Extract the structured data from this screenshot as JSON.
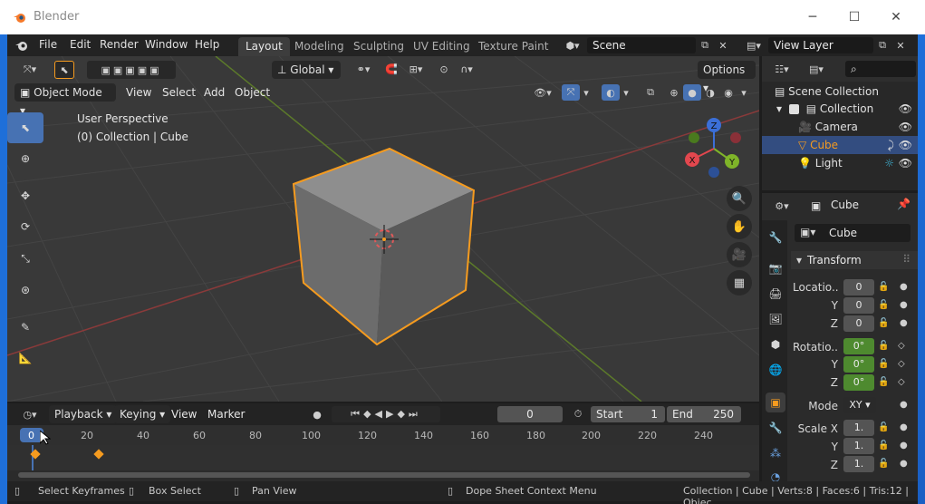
{
  "window": {
    "title": "Blender",
    "minimize": "─",
    "maximize": "☐",
    "close": "✕"
  },
  "menu": [
    "File",
    "Edit",
    "Render",
    "Window",
    "Help"
  ],
  "workspaces": [
    "Layout",
    "Modeling",
    "Sculpting",
    "UV Editing",
    "Texture Paint"
  ],
  "active_workspace": "Layout",
  "scene": {
    "label": "Scene"
  },
  "view_layer": {
    "label": "View Layer"
  },
  "viewport": {
    "transform_orientation": "Global",
    "options": "Options",
    "mode": "Object Mode",
    "menus": [
      "View",
      "Select",
      "Add",
      "Object"
    ],
    "overlay_title": "User Perspective",
    "overlay_subtitle": "(0) Collection | Cube",
    "gizmo": {
      "x": "X",
      "y": "Y",
      "z": "Z"
    }
  },
  "timeline": {
    "menus": [
      "Playback",
      "Keying",
      "View",
      "Marker"
    ],
    "current_frame": "0",
    "start_label": "Start",
    "start_value": "1",
    "end_label": "End",
    "end_value": "250",
    "ticks": [
      "0",
      "20",
      "40",
      "60",
      "80",
      "100",
      "120",
      "140",
      "160",
      "180",
      "200",
      "220",
      "240"
    ]
  },
  "outliner": {
    "root": "Scene Collection",
    "items": [
      {
        "label": "Collection"
      },
      {
        "label": "Camera"
      },
      {
        "label": "Cube"
      },
      {
        "label": "Light"
      }
    ]
  },
  "properties": {
    "object_name": "Cube",
    "data_name": "Cube",
    "panel": "Transform",
    "location_label": "Locatio..",
    "rotation_label": "Rotatio..",
    "mode_label": "Mode",
    "mode_value": "XY",
    "scale_label": "Scale X",
    "axis_y": "Y",
    "axis_z": "Z",
    "location": [
      "0",
      "0",
      "0"
    ],
    "rotation": [
      "0°",
      "0°",
      "0°"
    ],
    "scale": [
      "1.",
      "1.",
      "1."
    ]
  },
  "status": {
    "select": "Select Keyframes",
    "box": "Box Select",
    "pan": "Pan View",
    "context": "Dope Sheet Context Menu",
    "stats": "Collection | Cube | Verts:8 | Faces:6 | Tris:12 | Objec"
  },
  "colors": {
    "selection_orange": "#f59b1f",
    "accent_blue": "#4772b3",
    "green_field": "#4e8a2f"
  }
}
